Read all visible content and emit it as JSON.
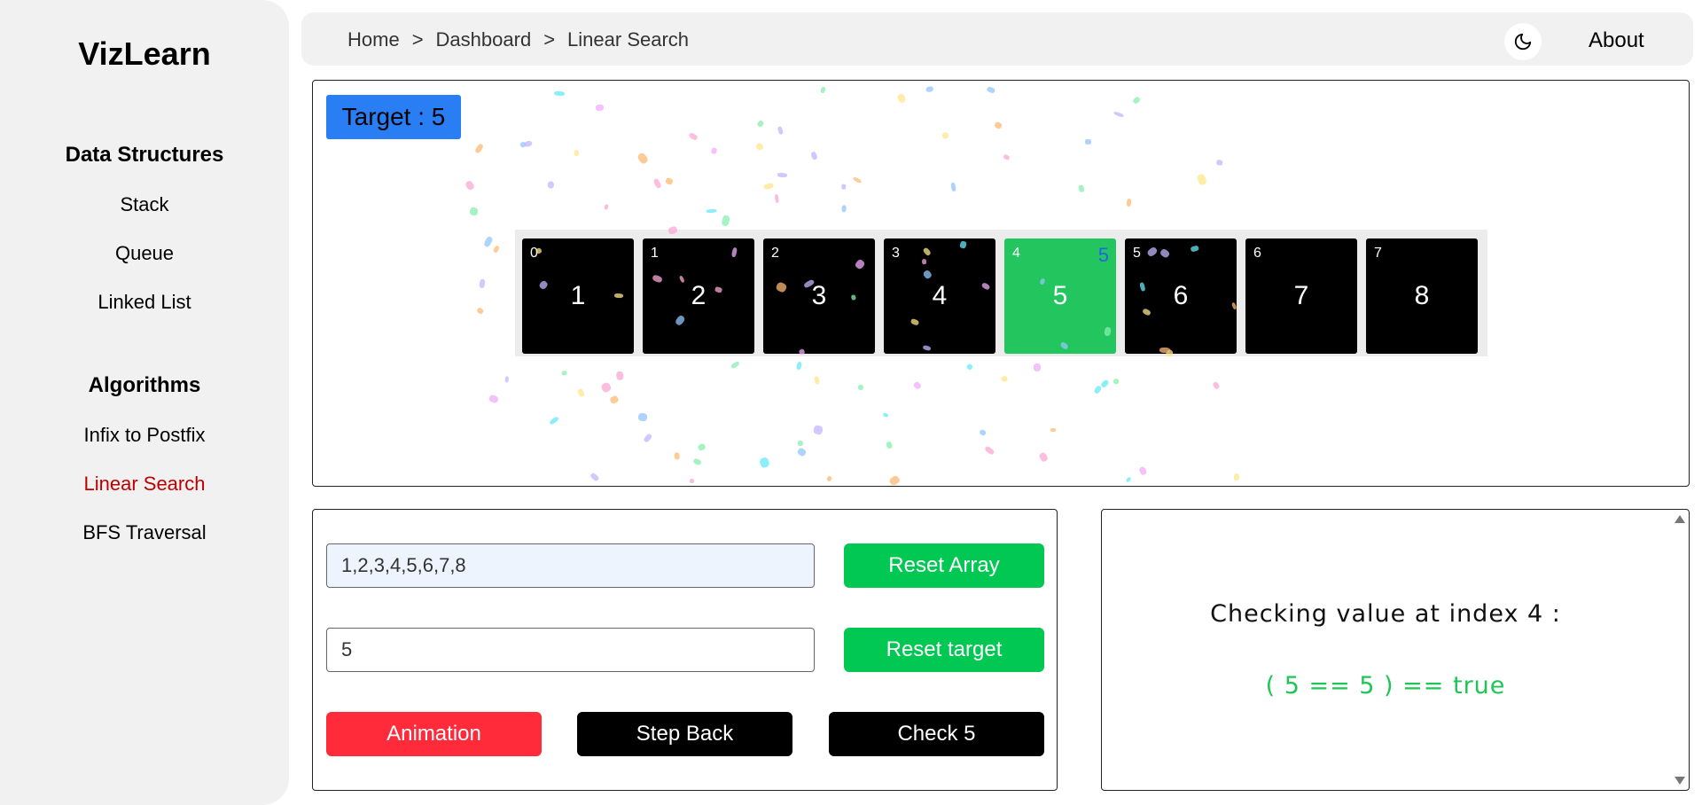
{
  "sidebar": {
    "logo": "VizLearn",
    "sections": [
      {
        "title": "Data Structures",
        "items": [
          "Stack",
          "Queue",
          "Linked List"
        ]
      },
      {
        "title": "Algorithms",
        "items": [
          "Infix to Postfix",
          "Linear Search",
          "BFS Traversal"
        ]
      }
    ],
    "active_item": "Linear Search"
  },
  "header": {
    "breadcrumb": [
      "Home",
      "Dashboard",
      "Linear Search"
    ],
    "separator": ">",
    "theme_icon": "moon-icon",
    "about_label": "About"
  },
  "visualizer": {
    "target_label": "Target : 5",
    "cells": [
      {
        "index": "0",
        "value": "1"
      },
      {
        "index": "1",
        "value": "2"
      },
      {
        "index": "2",
        "value": "3"
      },
      {
        "index": "3",
        "value": "4"
      },
      {
        "index": "4",
        "value": "5",
        "pointer": "5"
      },
      {
        "index": "5",
        "value": "6"
      },
      {
        "index": "6",
        "value": "7"
      },
      {
        "index": "7",
        "value": "8"
      }
    ],
    "highlight_color": "#22c55e"
  },
  "controls": {
    "array_input_value": "1,2,3,4,5,6,7,8",
    "target_input_value": "5",
    "reset_array_label": "Reset Array",
    "reset_target_label": "Reset target",
    "animation_label": "Animation",
    "step_back_label": "Step Back",
    "check_label": "Check 5"
  },
  "log": {
    "line1": "Checking value at index 4 :",
    "line2": "( 5 == 5 ) == true"
  },
  "colors": {
    "accent_blue": "#2a7ef4",
    "success_green": "#00c853",
    "danger_red": "#ff2a3a",
    "active_nav": "#c00000"
  }
}
